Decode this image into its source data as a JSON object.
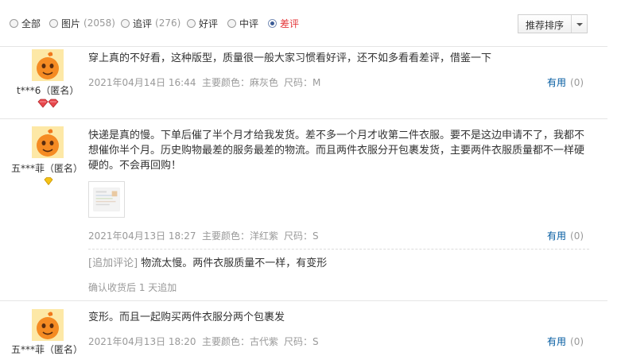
{
  "filters": [
    {
      "label": "全部",
      "count": ""
    },
    {
      "label": "图片",
      "count": "(2058)"
    },
    {
      "label": "追评",
      "count": "(276)"
    },
    {
      "label": "好评",
      "count": ""
    },
    {
      "label": "中评",
      "count": ""
    },
    {
      "label": "差评",
      "count": ""
    }
  ],
  "sort": {
    "label": "推荐排序"
  },
  "useful_label": "有用",
  "reviews": [
    {
      "user": "t***6（匿名）",
      "text": "穿上真的不好看，这种版型，质量很一般大家习惯看好评，还不如多看看差评，借鉴一下",
      "date": "2021年04月14日 16:44",
      "color": "主要颜色：麻灰色",
      "size": "尺码：M",
      "useful_count": "(0)"
    },
    {
      "user": "五***菲（匿名）",
      "text": "快递是真的慢。下单后催了半个月才给我发货。差不多一个月才收第二件衣服。要不是这边申请不了，我都不想催你半个月。历史购物最差的服务最差的物流。而且两件衣服分开包裹发货，主要两件衣服质量都不一样硬硬的。不会再回购！",
      "date": "2021年04月13日 18:27",
      "color": "主要颜色：洋红紫",
      "size": "尺码：S",
      "useful_count": "(0)",
      "append_tag": "[追加评论]",
      "append_text": "物流太慢。两件衣服质量不一样，有变形",
      "append_time": "确认收货后 1 天追加"
    },
    {
      "user": "五***菲（匿名）",
      "text": "变形。而且一起购买两件衣服分两个包裹发",
      "date": "2021年04月13日 18:20",
      "color": "主要颜色：古代紫",
      "size": "尺码：S",
      "useful_count": "(0)"
    }
  ]
}
